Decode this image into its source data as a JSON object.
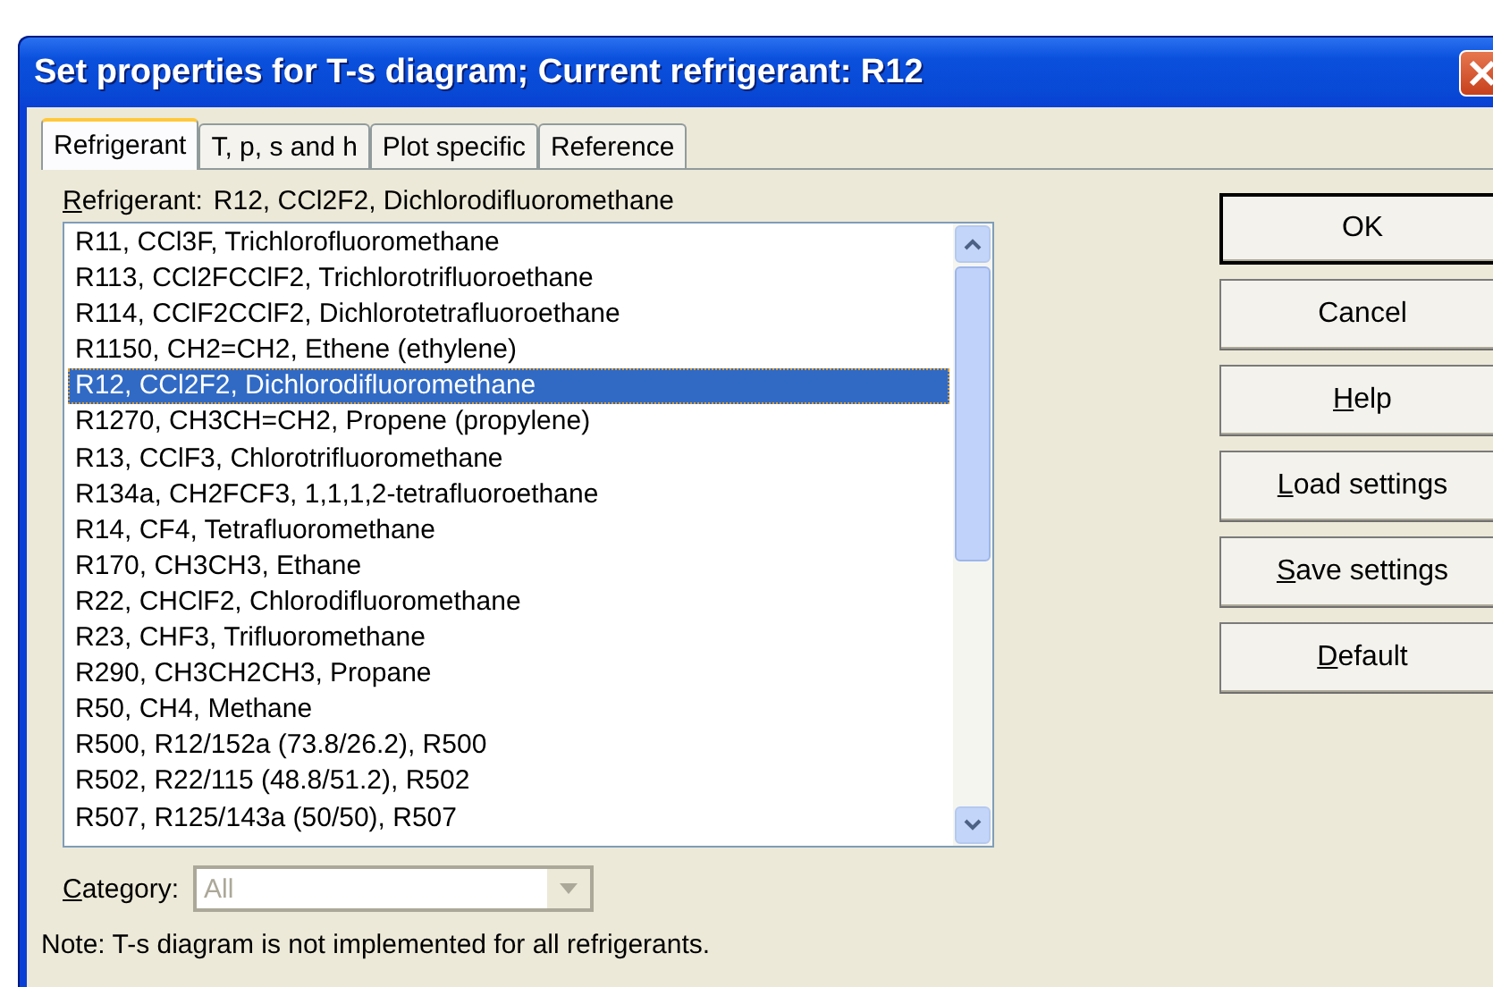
{
  "window": {
    "title": "Set properties for T-s diagram; Current refrigerant: R12"
  },
  "tabs": [
    {
      "label": "Refrigerant",
      "selected": true
    },
    {
      "label": "T, p, s and h",
      "selected": false
    },
    {
      "label": "Plot specific",
      "selected": false
    },
    {
      "label": "Reference",
      "selected": false
    }
  ],
  "refrigerant_label": {
    "text": "Refrigerant:",
    "mnemonic": true
  },
  "refrigerant_value": "R12, CCl2F2, Dichlorodifluoromethane",
  "refrigerant_list": [
    {
      "text": "R11, CCl3F, Trichlorofluoromethane",
      "selected": false
    },
    {
      "text": "R113, CCl2FCClF2, Trichlorotrifluoroethane",
      "selected": false
    },
    {
      "text": "R114, CClF2CClF2, Dichlorotetrafluoroethane",
      "selected": false
    },
    {
      "text": "R1150, CH2=CH2, Ethene (ethylene)",
      "selected": false
    },
    {
      "text": "R12, CCl2F2, Dichlorodifluoromethane",
      "selected": true
    },
    {
      "text": "R1270, CH3CH=CH2, Propene (propylene)",
      "selected": false
    },
    {
      "text": "R13, CClF3, Chlorotrifluoromethane",
      "selected": false
    },
    {
      "text": "R134a, CH2FCF3, 1,1,1,2-tetrafluoroethane",
      "selected": false
    },
    {
      "text": "R14, CF4, Tetrafluoromethane",
      "selected": false
    },
    {
      "text": "R170, CH3CH3, Ethane",
      "selected": false
    },
    {
      "text": "R22, CHClF2, Chlorodifluoromethane",
      "selected": false
    },
    {
      "text": "R23, CHF3, Trifluoromethane",
      "selected": false
    },
    {
      "text": "R290, CH3CH2CH3, Propane",
      "selected": false
    },
    {
      "text": "R50, CH4, Methane",
      "selected": false
    },
    {
      "text": "R500, R12/152a (73.8/26.2), R500",
      "selected": false
    },
    {
      "text": "R502, R22/115 (48.8/51.2), R502",
      "selected": false
    },
    {
      "text": "R507, R125/143a (50/50), R507",
      "selected": false
    }
  ],
  "category": {
    "label": "Category:",
    "mnemonic": true,
    "value": "All",
    "disabled": true
  },
  "buttons": [
    {
      "label": "OK",
      "mnemonic": false,
      "default": true
    },
    {
      "label": "Cancel",
      "mnemonic": false,
      "default": false
    },
    {
      "label": "Help",
      "mnemonic": true,
      "default": false
    },
    {
      "label": "Load settings",
      "mnemonic": true,
      "default": false
    },
    {
      "label": "Save settings",
      "mnemonic": true,
      "default": false
    },
    {
      "label": "Default",
      "mnemonic": true,
      "default": false
    }
  ],
  "note": "Note: T-s diagram is not implemented for all refrigerants."
}
